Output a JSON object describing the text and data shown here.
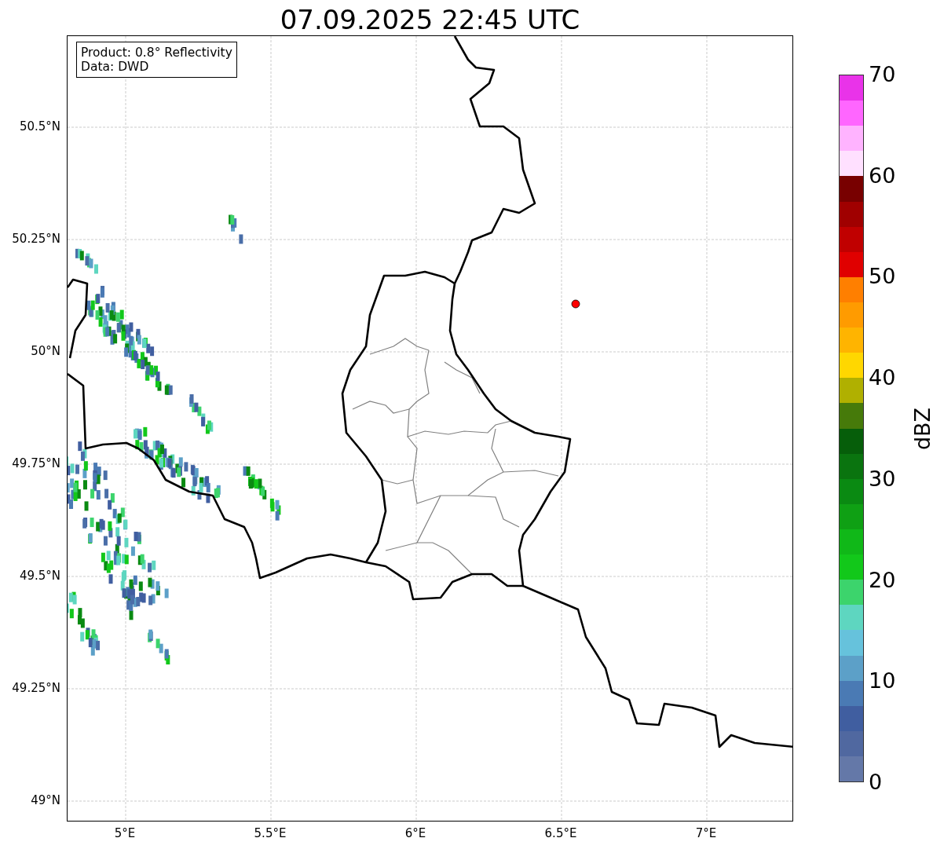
{
  "title": "07.09.2025 22:45 UTC",
  "info_box": {
    "lines": [
      "Product: 0.8° Reflectivity",
      "Data: DWD"
    ]
  },
  "map": {
    "lon_ticks": [
      "5°E",
      "5.5°E",
      "6°E",
      "6.5°E",
      "7°E"
    ],
    "lat_ticks": [
      "50.5°N",
      "50.25°N",
      "50°N",
      "49.75°N",
      "49.5°N",
      "49.25°N",
      "49°N"
    ]
  },
  "colorbar": {
    "label": "dBZ",
    "ticks": [
      "70",
      "60",
      "50",
      "40",
      "30",
      "20",
      "10",
      "0"
    ],
    "bins": [
      {
        "color": "#e933e9"
      },
      {
        "color": "#ff66ff"
      },
      {
        "color": "#ffb3ff"
      },
      {
        "color": "#ffe0ff"
      },
      {
        "color": "#780000"
      },
      {
        "color": "#a00000"
      },
      {
        "color": "#c00000"
      },
      {
        "color": "#e00000"
      },
      {
        "color": "#ff7f00"
      },
      {
        "color": "#ff9b00"
      },
      {
        "color": "#ffb400"
      },
      {
        "color": "#ffd700"
      },
      {
        "color": "#b0b000"
      },
      {
        "color": "#467a0a"
      },
      {
        "color": "#065e0a"
      },
      {
        "color": "#0a740f"
      },
      {
        "color": "#0a8a12"
      },
      {
        "color": "#0fa014"
      },
      {
        "color": "#10b818"
      },
      {
        "color": "#12c81a"
      },
      {
        "color": "#3cd46c"
      },
      {
        "color": "#5ed6c0"
      },
      {
        "color": "#66c2dc"
      },
      {
        "color": "#5ca0c8"
      },
      {
        "color": "#4a7ab4"
      },
      {
        "color": "#405ea0"
      },
      {
        "color": "#5068a0"
      },
      {
        "color": "#6478a8"
      }
    ]
  }
}
